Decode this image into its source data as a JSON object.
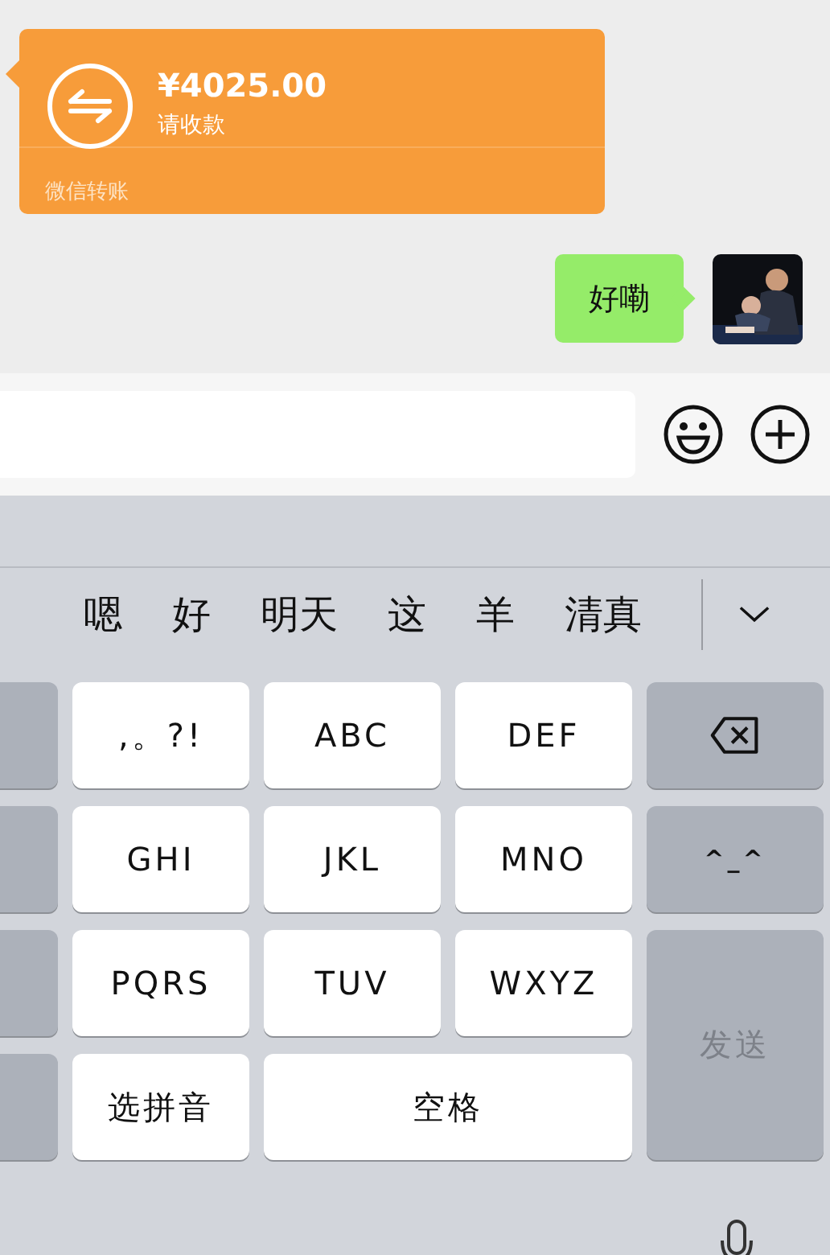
{
  "transfer": {
    "amount": "¥4025.00",
    "note": "请收款",
    "footer": "微信转账"
  },
  "reply": {
    "text": "好嘞"
  },
  "candidates": [
    "嗯",
    "好",
    "明天",
    "这",
    "羊",
    "清真"
  ],
  "keys": [
    {
      "kind": "side"
    },
    {
      "kind": "char",
      "label": ",。?!"
    },
    {
      "kind": "char",
      "label": "ABC"
    },
    {
      "kind": "char",
      "label": "DEF"
    },
    {
      "kind": "delete"
    },
    {
      "kind": "side"
    },
    {
      "kind": "char",
      "label": "GHI"
    },
    {
      "kind": "char",
      "label": "JKL"
    },
    {
      "kind": "char",
      "label": "MNO"
    },
    {
      "kind": "face",
      "label": "^_^"
    },
    {
      "kind": "side"
    },
    {
      "kind": "char",
      "label": "PQRS"
    },
    {
      "kind": "char",
      "label": "TUV"
    },
    {
      "kind": "char",
      "label": "WXYZ"
    },
    {
      "kind": "send",
      "label": "发送",
      "disabled": true
    },
    {
      "kind": "side"
    },
    {
      "kind": "char",
      "label": "选拼音"
    },
    {
      "kind": "space",
      "label": "空格"
    }
  ]
}
